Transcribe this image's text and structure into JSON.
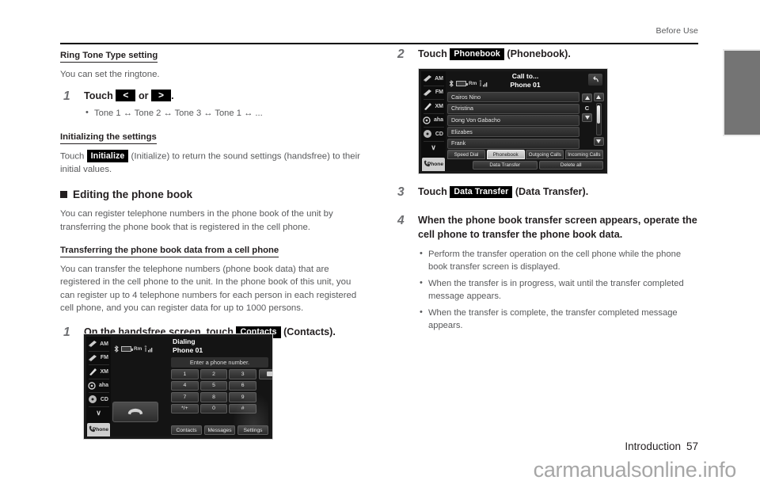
{
  "header": {
    "running_head": "Before Use"
  },
  "footer": {
    "section": "Introduction",
    "page_number": "57",
    "watermark": "carmanualsonline.info"
  },
  "left_column": {
    "ringtone": {
      "heading": "Ring Tone Type setting",
      "intro": "You can set the ringtone.",
      "step_number": "1",
      "step_prefix": "Touch",
      "chip_left": "<",
      "step_middle": "or",
      "chip_right": ">",
      "step_suffix": ".",
      "bullet": "Tone 1 ↔ Tone 2 ↔ Tone 3 ↔ Tone 1 ↔ ..."
    },
    "initializing": {
      "heading": "Initializing the settings",
      "prefix": "Touch",
      "chip": "Initialize",
      "suffix": "(Initialize) to return the sound settings (handsfree) to their initial values."
    },
    "editing": {
      "section_title": "Editing the phone book",
      "paragraph": "You can register telephone numbers in the phone book of the unit by transferring the phone book that is registered in the cell phone.",
      "transfer_heading": "Transferring the phone book data from a cell phone",
      "transfer_paragraph": "You can transfer the telephone numbers (phone book data) that are registered in the cell phone to the unit. In the phone book of this unit, you can register up to 4 telephone numbers for each person in each registered cell phone, and you can register data for up to 1000 persons.",
      "step_number": "1",
      "step_prefix": "On the handsfree screen, touch",
      "chip": "Contacts",
      "step_suffix": "(Contacts)."
    }
  },
  "right_column": {
    "step2": {
      "number": "2",
      "prefix": "Touch",
      "chip": "Phonebook",
      "suffix": "(Phonebook)."
    },
    "step3": {
      "number": "3",
      "prefix": "Touch",
      "chip": "Data Transfer",
      "suffix": "(Data Transfer)."
    },
    "step4": {
      "number": "4",
      "text": "When the phone book transfer screen appears, operate the cell phone to transfer the phone book data.",
      "bullets": [
        "Perform the transfer operation on the cell phone while the phone book transfer screen is displayed.",
        "When the transfer is in progress, wait until the transfer completed message appears.",
        "When the transfer is complete, the transfer completed message appears."
      ]
    }
  },
  "device_dialing": {
    "rail": [
      {
        "label": "AM",
        "icon": "radio-icon"
      },
      {
        "label": "FM",
        "icon": "radio-icon"
      },
      {
        "label": "XM",
        "icon": "satellite-radio-icon"
      },
      {
        "label": "aha",
        "icon": "aha-icon"
      },
      {
        "label": "CD",
        "icon": "disc-icon"
      },
      {
        "label": "∨",
        "icon": "chevron-down-icon"
      },
      {
        "label": "Phone",
        "icon": "phone-icon"
      }
    ],
    "status": {
      "bluetooth": "bt-icon",
      "battery": "battery-icon",
      "roaming": "Rm",
      "signal": "signal-icon"
    },
    "title_line1": "Dialing",
    "title_line2": "Phone 01",
    "message": "Enter a phone number.",
    "keypad": [
      "1",
      "2",
      "3",
      "4",
      "5",
      "6",
      "7",
      "8",
      "9",
      "*/+",
      "0",
      "#"
    ],
    "backspace": "backspace-icon",
    "call_button": "call-icon",
    "bottom_buttons": [
      "Contacts",
      "Messages",
      "Settings"
    ]
  },
  "device_phonebook": {
    "rail": [
      {
        "label": "AM",
        "icon": "radio-icon"
      },
      {
        "label": "FM",
        "icon": "radio-icon"
      },
      {
        "label": "XM",
        "icon": "satellite-radio-icon"
      },
      {
        "label": "aha",
        "icon": "aha-icon"
      },
      {
        "label": "CD",
        "icon": "disc-icon"
      },
      {
        "label": "∨",
        "icon": "chevron-down-icon"
      },
      {
        "label": "Phone",
        "icon": "phone-icon"
      }
    ],
    "status": {
      "bluetooth": "bt-icon",
      "battery": "battery-icon",
      "roaming": "Rm",
      "signal": "signal-icon"
    },
    "title_line1": "Call to...",
    "title_line2": "Phone 01",
    "back_button": "back-arrow-icon",
    "contacts": [
      "Cairos Nino",
      "Christina",
      "Dong Von Gabacho",
      "Elizabes",
      "Frank"
    ],
    "index_letter": "C",
    "tabs": [
      "Speed Dial",
      "Phonebook",
      "Outgoing Calls",
      "Incoming Calls"
    ],
    "active_tab": "Phonebook",
    "actions": [
      "Data Transfer",
      "Delete all"
    ]
  }
}
